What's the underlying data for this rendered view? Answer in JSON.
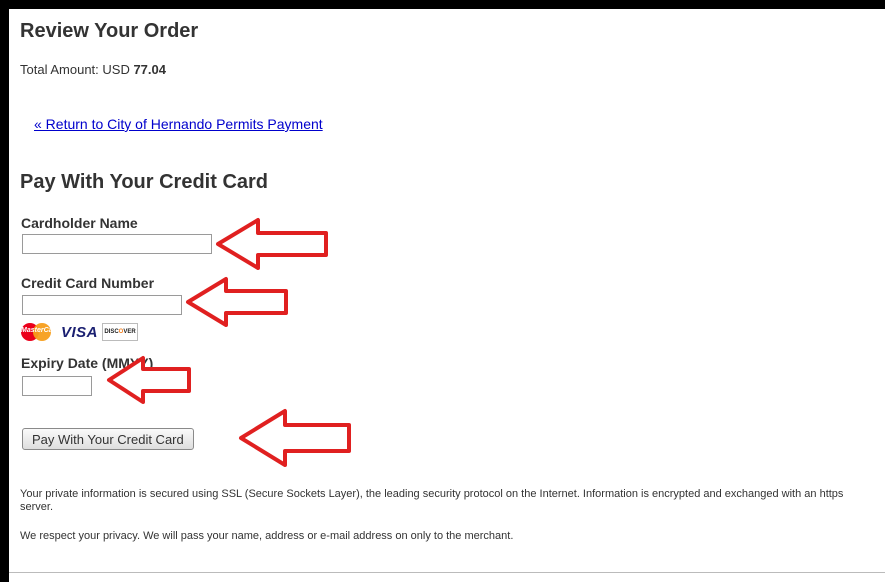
{
  "review": {
    "title": "Review Your Order",
    "total_label": "Total Amount: USD ",
    "total_value": "77.04",
    "return_link": "« Return to City of Hernando Permits Payment"
  },
  "payment": {
    "heading": "Pay With Your Credit Card",
    "cardholder_label": "Cardholder Name",
    "cardholder_value": "",
    "card_number_label": "Credit Card Number",
    "card_number_value": "",
    "cards": {
      "mastercard": "MasterCard",
      "visa": "VISA",
      "discover_pre": "DISC",
      "discover_o": "O",
      "discover_post": "VER"
    },
    "expiry_label": "Expiry Date (MMYY)",
    "expiry_value": "",
    "submit_label": "Pay With Your Credit Card"
  },
  "notes": {
    "security": "Your private information is secured using SSL (Secure Sockets Layer), the leading security protocol on the Internet. Information is encrypted and exchanged with an https server.",
    "privacy": "We respect your privacy. We will pass your name, address or e-mail address on only to the merchant."
  },
  "colors": {
    "arrow": "#e02020",
    "link": "#0000cc"
  }
}
